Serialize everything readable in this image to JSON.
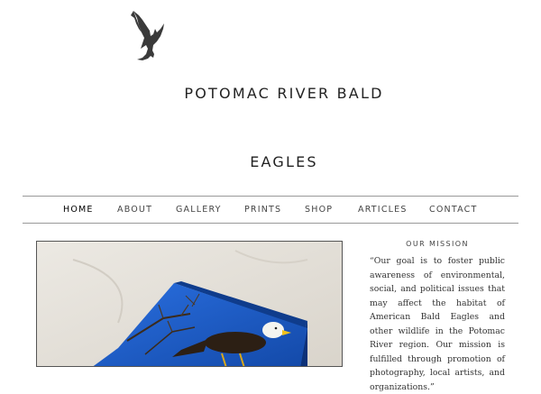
{
  "header": {
    "logo_icon": "eagle-icon",
    "title_line1": "POTOMAC RIVER BALD",
    "title_line2": "EAGLES"
  },
  "nav": {
    "items": [
      {
        "label": "HOME",
        "active": true
      },
      {
        "label": "ABOUT",
        "active": false
      },
      {
        "label": "GALLERY",
        "active": false
      },
      {
        "label": "PRINTS",
        "active": false
      },
      {
        "label": "SHOP",
        "active": false
      },
      {
        "label": "ARTICLES",
        "active": false
      },
      {
        "label": "CONTACT",
        "active": false
      }
    ]
  },
  "sidebar": {
    "mission_heading": "OUR MISSION",
    "mission_text": "“Our goal is to foster public awareness of environmental, social, and political issues that may affect the habitat of American Bald Eagles and other wildlife in the Potomac River region. Our mission is fulfilled through promotion of photography, local artists, and organizations.”"
  },
  "colors": {
    "rule": "#999999",
    "canvas_sky": "#1d5cc8",
    "backdrop": "#e9e5de"
  }
}
